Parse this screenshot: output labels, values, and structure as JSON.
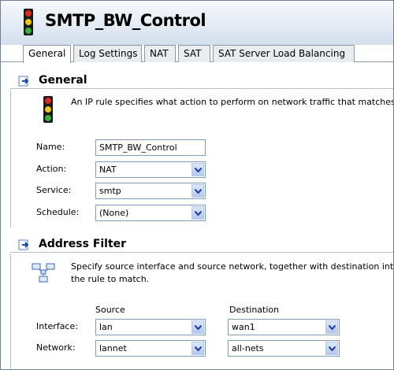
{
  "window": {
    "title": "SMTP_BW_Control",
    "icon": "traffic-light-icon"
  },
  "tabs": [
    {
      "label": "General",
      "active": true
    },
    {
      "label": "Log Settings",
      "active": false
    },
    {
      "label": "NAT",
      "active": false
    },
    {
      "label": "SAT",
      "active": false
    },
    {
      "label": "SAT Server Load Balancing",
      "active": false
    }
  ],
  "general": {
    "title": "General",
    "description": "An IP rule specifies what action to perform on network traffic that matches",
    "fields": {
      "name_label": "Name:",
      "name_value": "SMTP_BW_Control",
      "action_label": "Action:",
      "action_value": "NAT",
      "service_label": "Service:",
      "service_value": "smtp",
      "schedule_label": "Schedule:",
      "schedule_value": "(None)"
    }
  },
  "address_filter": {
    "title": "Address Filter",
    "description_line1": "Specify source interface and source network, together with destination inte",
    "description_line2": "the rule to match.",
    "source_header": "Source",
    "destination_header": "Destination",
    "interface_label": "Interface:",
    "network_label": "Network:",
    "source_interface": "lan",
    "source_network": "lannet",
    "destination_interface": "wan1",
    "destination_network": "all-nets"
  },
  "colors": {
    "accent": "#1f3a9c",
    "header_gradient_top": "#f7f9fc",
    "header_gradient_bottom": "#d3deec"
  }
}
